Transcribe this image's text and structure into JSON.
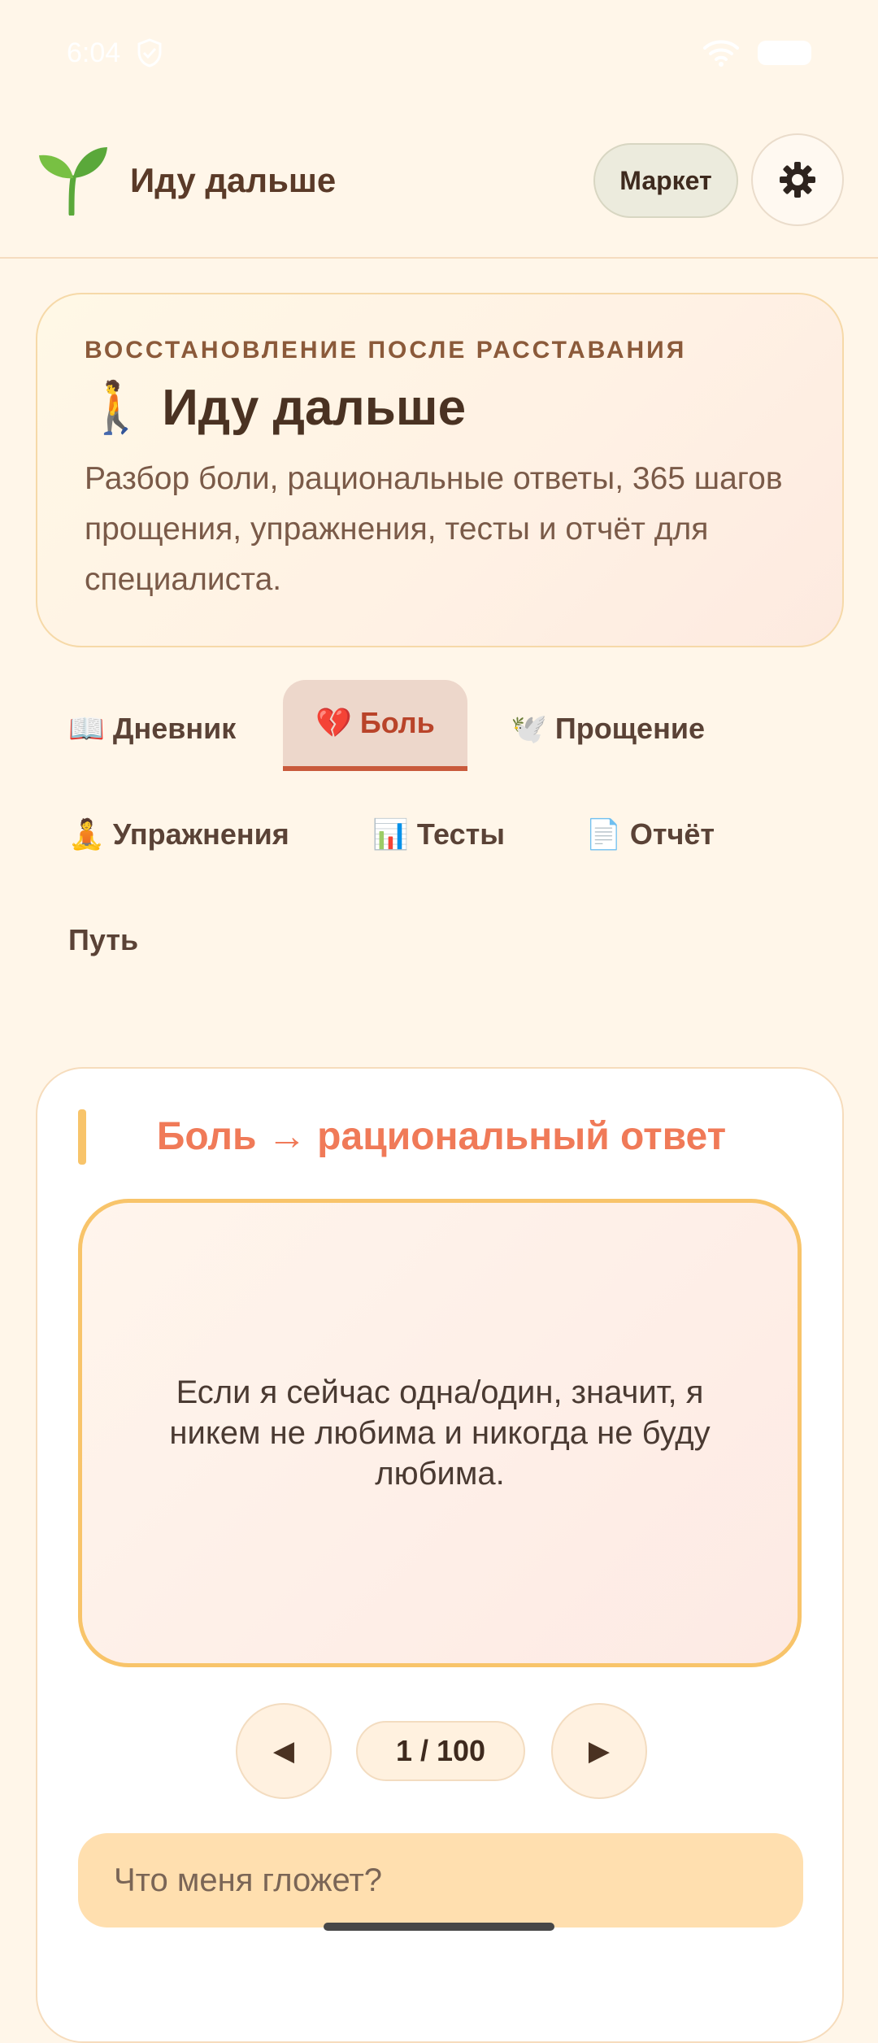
{
  "status": {
    "time": "6:04"
  },
  "header": {
    "title": "Иду дальше",
    "market_label": "Маркет"
  },
  "hero": {
    "kicker": "ВОССТАНОВЛЕНИЕ ПОСЛЕ РАССТАВАНИЯ",
    "title_emoji": "🚶",
    "title": "Иду дальше",
    "description": "Разбор боли, рациональные ответы, 365 шагов прощения, упражнения, тесты и отчёт для специалиста."
  },
  "tabs": [
    {
      "emoji": "📖",
      "label": "Дневник"
    },
    {
      "emoji": "💔",
      "label": "Боль"
    },
    {
      "emoji": "🕊️",
      "label": "Прощение"
    },
    {
      "emoji": "🧘",
      "label": "Упражнения"
    },
    {
      "emoji": "📊",
      "label": "Тесты"
    },
    {
      "emoji": "📄",
      "label": "Отчёт"
    },
    {
      "emoji": "",
      "label": "Путь"
    }
  ],
  "active_tab": "Боль",
  "card": {
    "title": "Боль → рациональный ответ",
    "thought": "Если я сейчас одна/один, значит, я никем не любима и никогда не буду любима.",
    "prev_symbol": "◀",
    "next_symbol": "▶",
    "counter": "1 / 100",
    "input_placeholder": "Что меня гложет?"
  },
  "colors": {
    "background": "#fff6e9",
    "accent": "#f07a58",
    "active_tab": "#c95a3c",
    "card_border": "#f8c46a"
  }
}
